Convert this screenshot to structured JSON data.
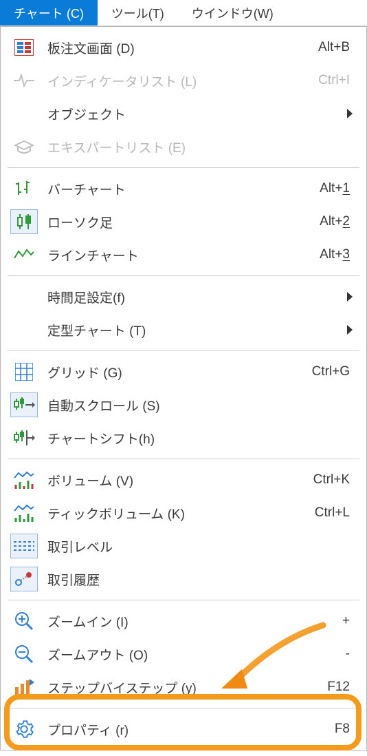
{
  "menubar": {
    "items": [
      {
        "label": "チャート (C)",
        "active": true
      },
      {
        "label": "ツール(T)"
      },
      {
        "label": "ウインドウ(W)"
      }
    ]
  },
  "menu": {
    "groups": [
      [
        {
          "id": "depth-of-market",
          "icon": "dom-icon",
          "label": "板注文画面 (D)",
          "accel": "Alt+B",
          "disabled": false
        },
        {
          "id": "indicator-list",
          "icon": "pulse-icon",
          "label": "インディケータリスト (L)",
          "accel": "Ctrl+I",
          "disabled": true
        },
        {
          "id": "objects",
          "icon": "",
          "label": "オブジェクト",
          "submenu": true,
          "disabled": false
        },
        {
          "id": "expert-list",
          "icon": "hat-icon",
          "label": "エキスパートリスト (E)",
          "accel": "",
          "disabled": true
        }
      ],
      [
        {
          "id": "bar-chart",
          "icon": "bar-chart-icon",
          "label": "バーチャート",
          "accel": "Alt+",
          "accel_underline": "1"
        },
        {
          "id": "candlesticks",
          "icon": "candlestick-icon",
          "iconboxed": true,
          "label": "ローソク足",
          "accel": "Alt+",
          "accel_underline": "2"
        },
        {
          "id": "line-chart",
          "icon": "line-chart-icon",
          "label": "ラインチャート",
          "accel": "Alt+",
          "accel_underline": "3"
        }
      ],
      [
        {
          "id": "timeframes",
          "icon": "",
          "label": "時間足設定(f)",
          "submenu": true
        },
        {
          "id": "templates",
          "icon": "",
          "label": "定型チャート (T)",
          "submenu": true
        }
      ],
      [
        {
          "id": "grid",
          "icon": "grid-icon",
          "label": "グリッド (G)",
          "accel": "Ctrl+G"
        },
        {
          "id": "auto-scroll",
          "icon": "autoscroll-icon",
          "iconboxed": true,
          "label": "自動スクロール (S)"
        },
        {
          "id": "chart-shift",
          "icon": "chartshift-icon",
          "label": "チャートシフト(h)"
        }
      ],
      [
        {
          "id": "volumes",
          "icon": "volumes-icon",
          "label": "ボリューム (V)",
          "accel": "Ctrl+K"
        },
        {
          "id": "tick-volumes",
          "icon": "tick-volumes-icon",
          "label": "ティックボリューム (K)",
          "accel": "Ctrl+L"
        },
        {
          "id": "trade-levels",
          "icon": "trade-levels-icon",
          "iconboxed": true,
          "label": "取引レベル"
        },
        {
          "id": "trade-history",
          "icon": "trade-history-icon",
          "iconboxed": true,
          "label": "取引履歴"
        }
      ],
      [
        {
          "id": "zoom-in",
          "icon": "zoom-in-icon",
          "label": "ズームイン (I)",
          "accel": "+"
        },
        {
          "id": "zoom-out",
          "icon": "zoom-out-icon",
          "label": "ズームアウト (O)",
          "accel": "-"
        },
        {
          "id": "step-by-step",
          "icon": "step-icon",
          "label": "ステップバイステップ (y)",
          "accel": "F12"
        }
      ],
      [
        {
          "id": "properties",
          "icon": "gear-icon",
          "label": "プロパティ (r)",
          "accel": "F8"
        }
      ]
    ]
  },
  "colors": {
    "active_menu_bg": "#0a7cd8",
    "highlight_border": "#f49b1e"
  }
}
